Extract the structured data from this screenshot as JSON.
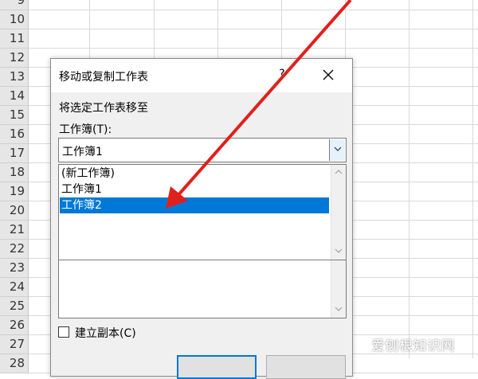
{
  "sheet": {
    "rows": [
      "9",
      "10",
      "11",
      "12",
      "13",
      "14",
      "15",
      "16",
      "17",
      "18",
      "19",
      "20",
      "21",
      "22",
      "23",
      "24",
      "25",
      "26",
      "27",
      "28"
    ]
  },
  "dialog": {
    "title": "移动或复制工作表",
    "help_label": "?",
    "move_label": "将选定工作表移至",
    "workbook_label": "工作簿(T):",
    "workbook_value": "工作簿1",
    "list_items": [
      "(新工作簿)",
      "工作簿1",
      "工作簿2"
    ],
    "selected_item": "工作簿2",
    "copy_label": "建立副本(C)",
    "copy_checked": false
  },
  "watermark": "爱刨根知识网",
  "colors": {
    "selection": "#0078d7",
    "arrow": "#e0201c"
  }
}
